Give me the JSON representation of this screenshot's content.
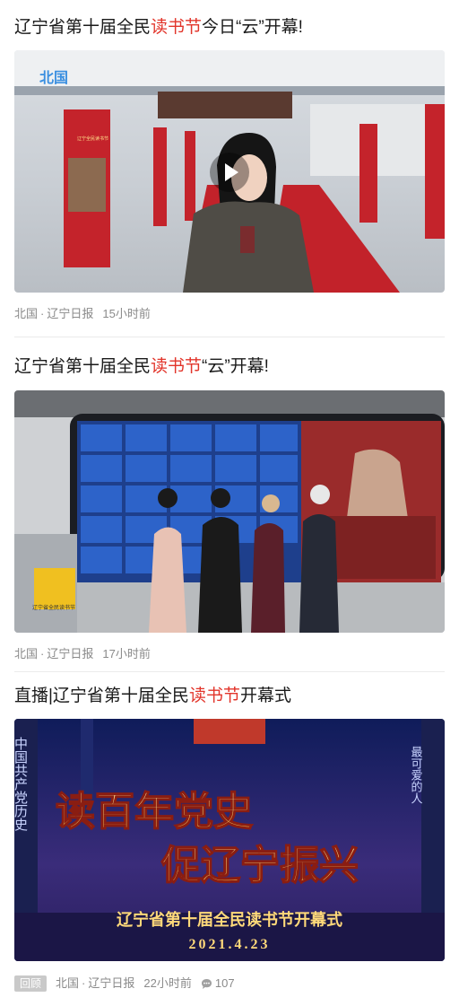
{
  "articles": [
    {
      "title_pre": "辽宁省第十届全民",
      "title_hl": "读书节",
      "title_post": "今日“云”开幕!",
      "thumb_watermark": "北国",
      "thumb_sign": "辽宁全民读书节",
      "source": "北国",
      "source2": "辽宁日报",
      "time": "15小时前"
    },
    {
      "title_pre": "辽宁省第十届全民",
      "title_hl": "读书节",
      "title_post": "“云”开幕!",
      "thumb_sign": "辽宁省全民读书节",
      "source": "北国",
      "source2": "辽宁日报",
      "time": "17小时前"
    },
    {
      "title_pre": "直播|辽宁省第十届全民",
      "title_hl": "读书节",
      "title_post": "开幕式",
      "poster_line1": "读百年党史",
      "poster_line2": "促辽宁振兴",
      "poster_subtitle": "辽宁省第十届全民读书节开幕式",
      "poster_date": "2021.4.23",
      "poster_side_left": "中国共产党历史",
      "poster_side_right": "最可爱的人",
      "tag": "回顾",
      "source": "北国",
      "source2": "辽宁日报",
      "time": "22小时前",
      "comments": "107"
    }
  ],
  "colors": {
    "highlight": "#e2352b",
    "meta": "#8a8a8a",
    "tag_bg": "#c9c9c9"
  }
}
